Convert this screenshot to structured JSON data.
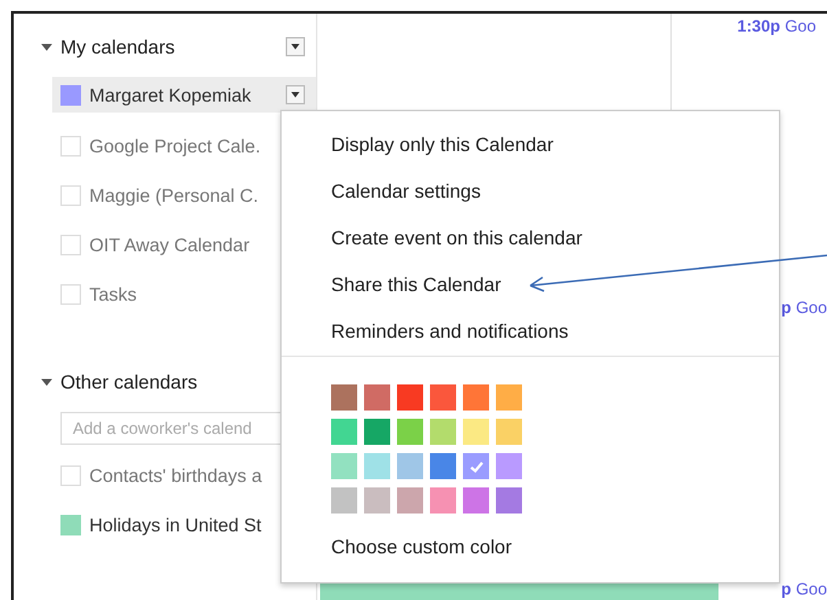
{
  "sidebar": {
    "sections": [
      {
        "title": "My calendars",
        "expanded": true,
        "calendars": [
          {
            "label": "Margaret Kopemiak",
            "checked": true,
            "color": "#9999ff",
            "selected": true
          },
          {
            "label": "Google Project Cale.",
            "checked": false,
            "selected": false
          },
          {
            "label": "Maggie (Personal C.",
            "checked": false,
            "selected": false
          },
          {
            "label": "OIT Away Calendar",
            "checked": false,
            "selected": false
          },
          {
            "label": "Tasks",
            "checked": false,
            "selected": false
          }
        ]
      },
      {
        "title": "Other calendars",
        "expanded": true,
        "add_field": {
          "placeholder": "Add a coworker's calend"
        },
        "calendars": [
          {
            "label": "Contacts' birthdays a",
            "checked": false,
            "selected": false
          },
          {
            "label": "Holidays in United St",
            "checked": true,
            "color": "#8fdcb8",
            "selected": false
          }
        ]
      }
    ]
  },
  "events": [
    {
      "time": "1:30p",
      "title": "Goo"
    },
    {
      "time": "p",
      "title": "Goo"
    },
    {
      "time": "p",
      "title": "Goo"
    }
  ],
  "menu": {
    "items": [
      "Display only this Calendar",
      "Calendar settings",
      "Create event on this calendar",
      "Share this Calendar",
      "Reminders and notifications"
    ],
    "palette": [
      {
        "color": "#ac725e",
        "selected": false
      },
      {
        "color": "#d06b64",
        "selected": false
      },
      {
        "color": "#f83a22",
        "selected": false
      },
      {
        "color": "#fa573c",
        "selected": false
      },
      {
        "color": "#ff7537",
        "selected": false
      },
      {
        "color": "#ffad46",
        "selected": false
      },
      {
        "color": "#42d692",
        "selected": false
      },
      {
        "color": "#16a765",
        "selected": false
      },
      {
        "color": "#7bd148",
        "selected": false
      },
      {
        "color": "#b3dc6c",
        "selected": false
      },
      {
        "color": "#fbe983",
        "selected": false
      },
      {
        "color": "#fad165",
        "selected": false
      },
      {
        "color": "#92e1c0",
        "selected": false
      },
      {
        "color": "#9fe1e7",
        "selected": false
      },
      {
        "color": "#9fc6e7",
        "selected": false
      },
      {
        "color": "#4986e7",
        "selected": false
      },
      {
        "color": "#9a9cff",
        "selected": true
      },
      {
        "color": "#b99aff",
        "selected": false
      },
      {
        "color": "#c2c2c2",
        "selected": false
      },
      {
        "color": "#cabdbf",
        "selected": false
      },
      {
        "color": "#cca6ac",
        "selected": false
      },
      {
        "color": "#f691b2",
        "selected": false
      },
      {
        "color": "#cd74e6",
        "selected": false
      },
      {
        "color": "#a47ae2",
        "selected": false
      }
    ],
    "custom_color": "Choose custom color"
  }
}
